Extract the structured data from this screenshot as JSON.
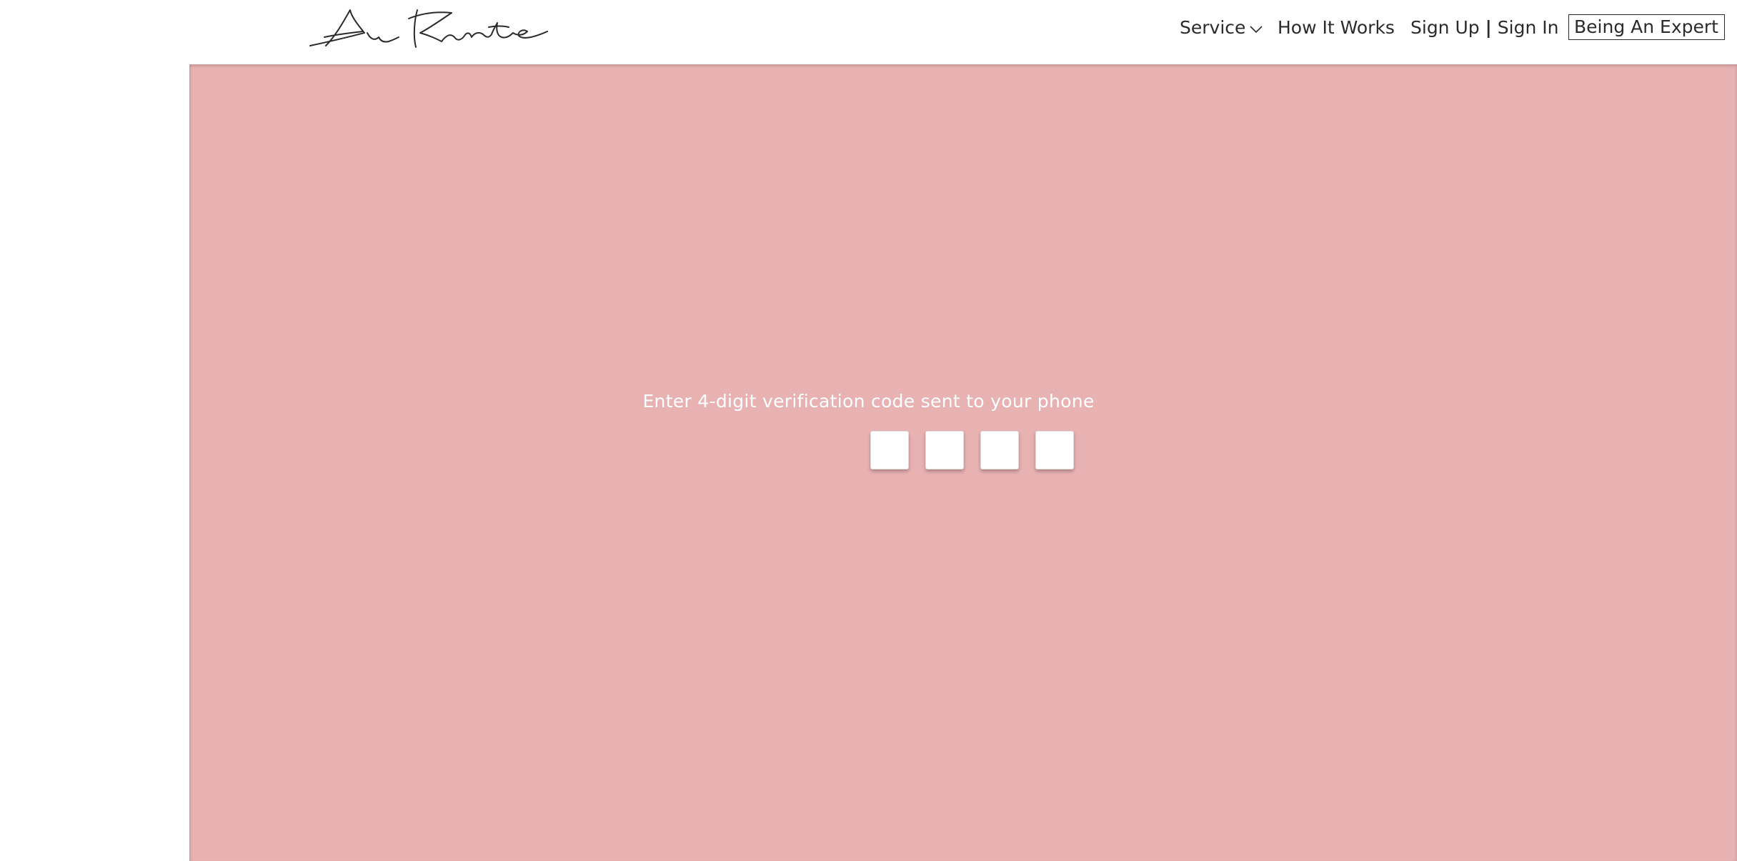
{
  "header": {
    "logo_text": "Au Kurate",
    "nav": {
      "service": "Service",
      "how_it_works": "How It Works",
      "sign_up": "Sign Up",
      "separator": "|",
      "sign_in": "Sign In",
      "being_expert": "Being An Expert"
    }
  },
  "verification": {
    "prompt": "Enter 4-digit verification code sent to your phone",
    "digits": [
      "",
      "",
      "",
      ""
    ]
  },
  "colors": {
    "panel_background": "#e8b1b2",
    "text_dark": "#2b2b2b",
    "text_light": "#ffffff"
  },
  "icons": {
    "service_dropdown": "chevron-down-icon"
  }
}
